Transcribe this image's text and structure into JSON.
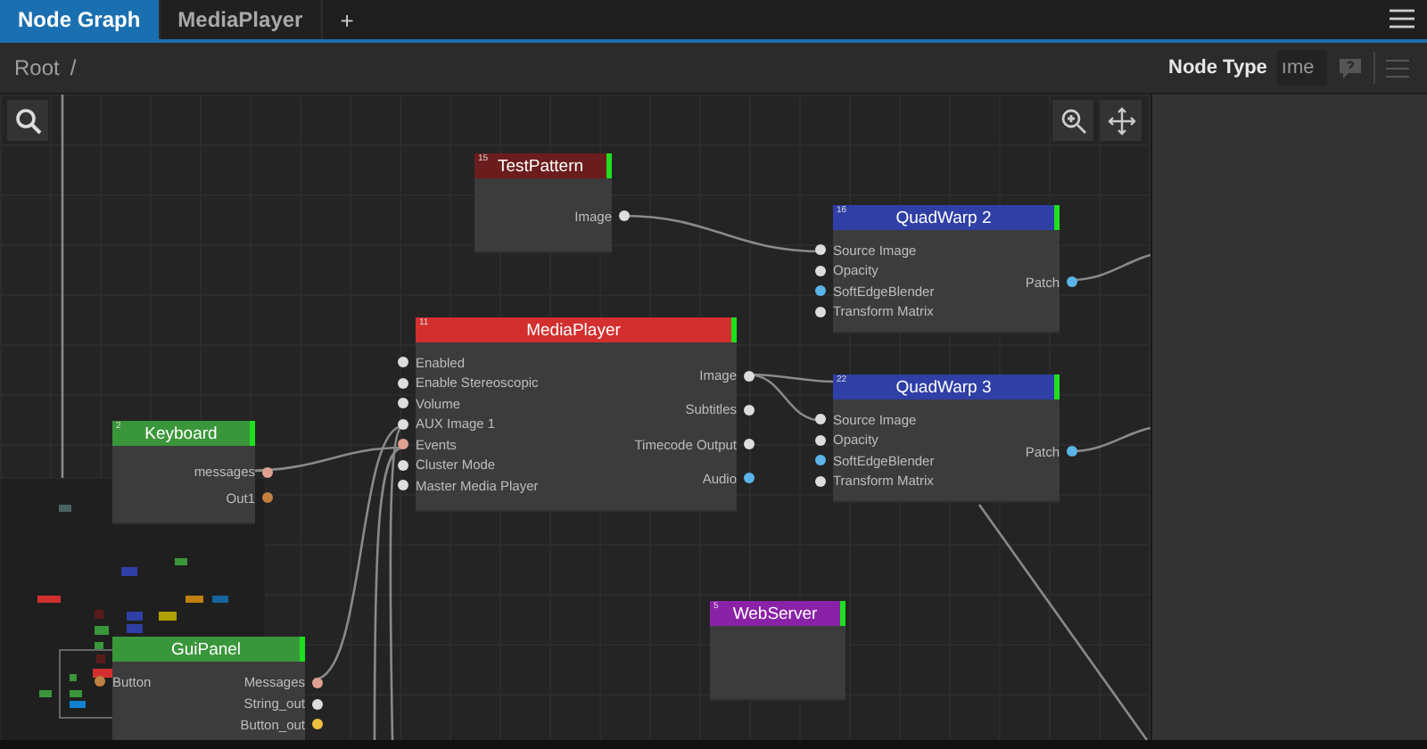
{
  "tabs": [
    {
      "label": "Node Graph",
      "selected": true
    },
    {
      "label": "MediaPlayer",
      "selected": false
    }
  ],
  "add_tab": "+",
  "breadcrumb": {
    "path": "Root",
    "separator": "/"
  },
  "nodes": [
    {
      "title": "TestPattern",
      "number": "15",
      "color": "#6b1c1c",
      "outputs": [
        {
          "label": "Image",
          "color": "#dddddd"
        }
      ]
    },
    {
      "title": "QuadWarp 2",
      "number": "16",
      "color": "#2f3fa6",
      "inputs": [
        {
          "label": "Source Image",
          "color": "#dddddd"
        },
        {
          "label": "Opacity",
          "color": "#dddddd"
        },
        {
          "label": "SoftEdgeBlender",
          "color": "#5ab4e8"
        },
        {
          "label": "Transform Matrix",
          "color": "#dddddd"
        }
      ],
      "outputs": [
        {
          "label": "Patch",
          "color": "#5ab4e8"
        }
      ]
    },
    {
      "title": "MediaPlayer",
      "number": "11",
      "color": "#d32f2f",
      "inputs": [
        {
          "label": "Enabled",
          "color": "#dddddd"
        },
        {
          "label": "Enable Stereoscopic",
          "color": "#dddddd"
        },
        {
          "label": "Volume",
          "color": "#dddddd"
        },
        {
          "label": "AUX Image 1",
          "color": "#dddddd"
        },
        {
          "label": "Events",
          "color": "#e0a090"
        },
        {
          "label": "Cluster Mode",
          "color": "#dddddd"
        },
        {
          "label": "Master Media Player",
          "color": "#dddddd"
        }
      ],
      "outputs": [
        {
          "label": "Image",
          "color": "#dddddd"
        },
        {
          "label": "Subtitles",
          "color": "#dddddd"
        },
        {
          "label": "Timecode Output",
          "color": "#dddddd"
        },
        {
          "label": "Audio",
          "color": "#5ab4e8"
        }
      ]
    },
    {
      "title": "QuadWarp 3",
      "number": "22",
      "color": "#2f3fa6",
      "inputs": [
        {
          "label": "Source Image",
          "color": "#dddddd"
        },
        {
          "label": "Opacity",
          "color": "#dddddd"
        },
        {
          "label": "SoftEdgeBlender",
          "color": "#5ab4e8"
        },
        {
          "label": "Transform Matrix",
          "color": "#dddddd"
        }
      ],
      "outputs": [
        {
          "label": "Patch",
          "color": "#5ab4e8"
        }
      ]
    },
    {
      "title": "Keyboard",
      "number": "2",
      "color": "#3a963a",
      "outputs": [
        {
          "label": "messages",
          "color": "#e0a090"
        },
        {
          "label": "Out1",
          "color": "#c08040"
        }
      ]
    },
    {
      "title": "GuiPanel",
      "color": "#3a963a",
      "inputs": [
        {
          "label": "Button",
          "color": "#c08040"
        }
      ],
      "outputs": [
        {
          "label": "Messages",
          "color": "#e0a090"
        },
        {
          "label": "String_out",
          "color": "#dddddd"
        },
        {
          "label": "Button_out",
          "color": "#f0c040"
        }
      ]
    },
    {
      "title": "WebServer",
      "number": "5",
      "color": "#8a22a8"
    }
  ],
  "side_panel": {
    "title": "Node Type",
    "search": {
      "value": "ıme"
    }
  }
}
